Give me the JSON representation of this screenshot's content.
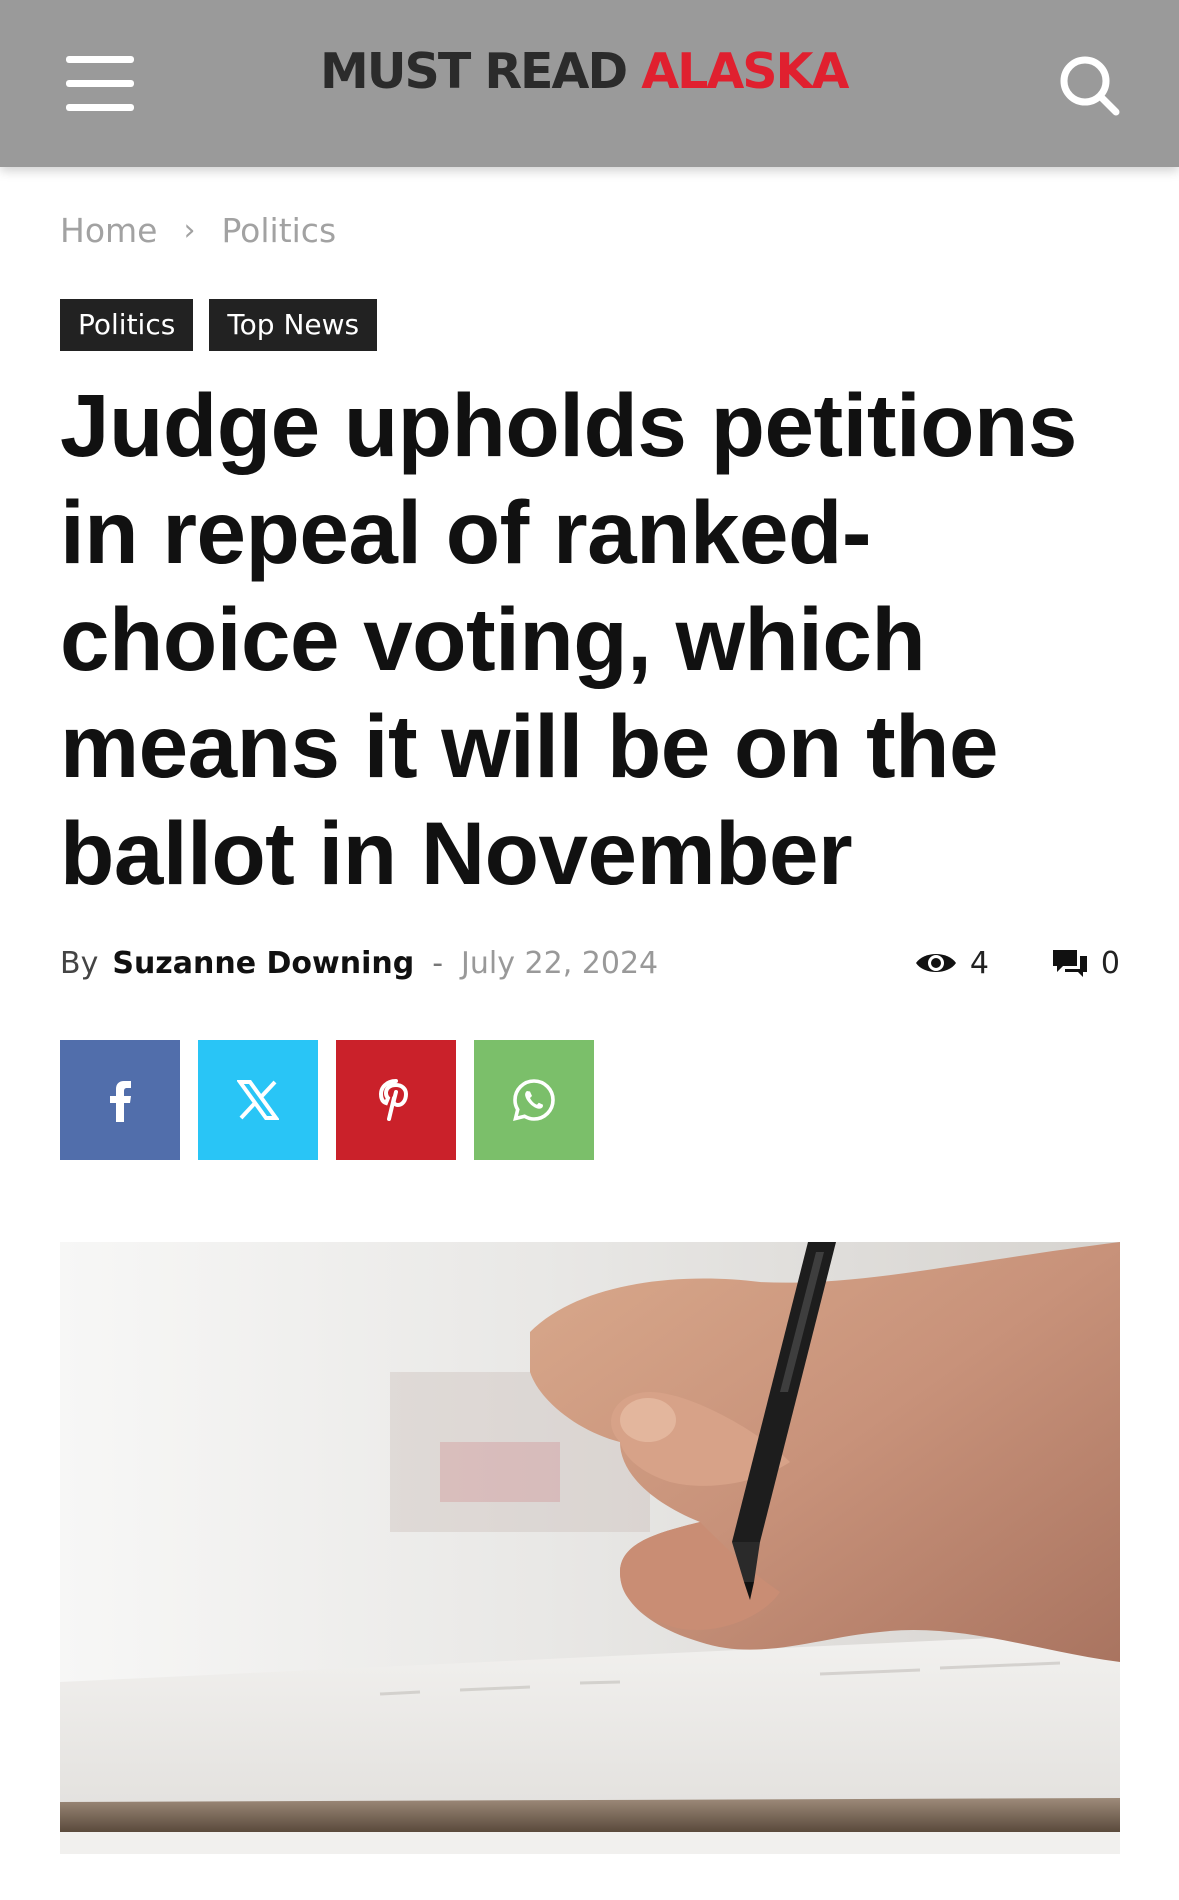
{
  "header": {
    "logo_part1": "MUST READ",
    "logo_part2": "ALASKA",
    "logo_dark_color": "#2b2b2b",
    "logo_red_color": "#e0202f",
    "background_color": "#9a9a9a",
    "menu_icon": "hamburger-menu-icon",
    "search_icon": "search-icon"
  },
  "breadcrumb": {
    "items": [
      "Home",
      "Politics"
    ],
    "separator": "›"
  },
  "tags": [
    "Politics",
    "Top News"
  ],
  "article": {
    "title": "Judge upholds petitions in repeal of ranked-choice voting, which means it will be on the ballot in November",
    "by_label": "By",
    "author": "Suzanne Downing",
    "separator": "-",
    "date": "July 22, 2024",
    "views": "4",
    "comments": "0"
  },
  "share_buttons": [
    {
      "name": "facebook",
      "icon": "facebook-icon",
      "color": "#516eab"
    },
    {
      "name": "x",
      "icon": "x-icon",
      "color": "#29c5f6"
    },
    {
      "name": "pinterest",
      "icon": "pinterest-icon",
      "color": "#ca212a"
    },
    {
      "name": "whatsapp",
      "icon": "whatsapp-icon",
      "color": "#7bbf6a"
    }
  ]
}
